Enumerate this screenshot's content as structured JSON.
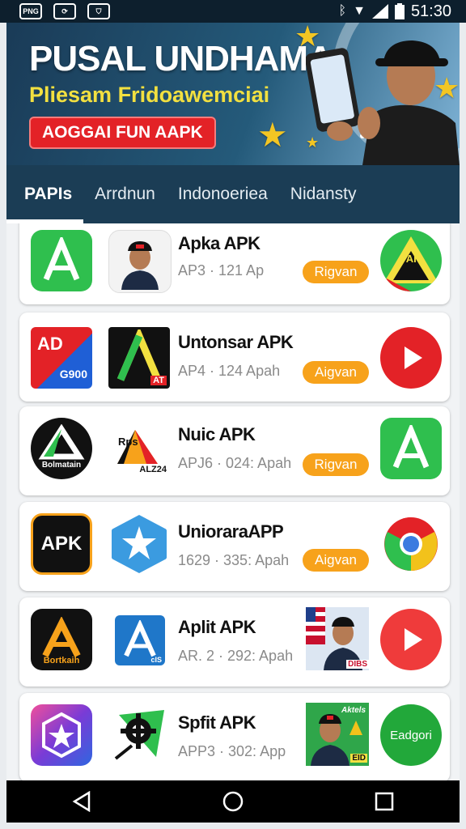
{
  "status_bar": {
    "icons": [
      "photo-icon",
      "sync-icon",
      "shield-icon"
    ],
    "photo_label": "PNG",
    "right_icons": [
      "bluetooth-icon",
      "wifi-icon",
      "signal-icon",
      "battery-icon"
    ],
    "time": "51:30"
  },
  "banner": {
    "title": "PUSAL UNDHAMA",
    "subtitle": "Pliesam Fridoawemciai",
    "button_label": "AOGGAI FUN AAPK",
    "colors": {
      "title": "#ffffff",
      "subtitle": "#f2e040",
      "button": "#e32227"
    }
  },
  "tabs": [
    {
      "label": "PAPIs",
      "active": true
    },
    {
      "label": "Arrdnun",
      "active": false
    },
    {
      "label": "Indonoeriea",
      "active": false
    },
    {
      "label": "Nidansty",
      "active": false
    }
  ],
  "apps": [
    {
      "name": "Apka APK",
      "meta": "AP3 · 121 Ap",
      "action": "Rigvan",
      "icon1": "green-a-icon",
      "icon2": "person-avatar-icon",
      "icon3": "triangle-flag-icon",
      "icon3_label": "PAI"
    },
    {
      "name": "Untonsar APK",
      "meta": "AP4 · 124 Apah",
      "action": "Aigvan",
      "icon1": "ad-badge-icon",
      "icon1_labels": [
        "AD",
        "G900"
      ],
      "icon2": "triangle-a-icon",
      "icon2_label": "AT",
      "icon3": "play-red-icon"
    },
    {
      "name": "Nuic APK",
      "meta": "APJ6 · 024: Apah",
      "action": "Rigvan",
      "icon1": "triangle-circle-icon",
      "icon1_label": "Bolmatain",
      "icon2": "arrow-logo-icon",
      "icon2_labels": [
        "Rps",
        "ALZ24"
      ],
      "icon3": "green-a-icon"
    },
    {
      "name": "UnioraraAPP",
      "meta": "1629 · 335: Apah",
      "action": "Aigvan",
      "icon1": "apk-badge-icon",
      "icon1_label": "APK",
      "icon2": "star-badge-icon",
      "icon3": "chrome-icon"
    },
    {
      "name": "Aplit APK",
      "meta": "AR. 2 · 292: Apah",
      "action": "",
      "icon1": "gold-a-icon",
      "icon1_label": "Bortkaih",
      "icon2": "blue-a-icon",
      "icon2_label": "cIS",
      "icon3": "person-flag-icon",
      "icon3_label": "DIBS"
    },
    {
      "name": "Spfit APK",
      "meta": "APP3 · 302: App",
      "action": "",
      "icon1": "purple-star-icon",
      "icon2": "gear-icon",
      "icon3": "person-green-icon",
      "icon3_label": "EID",
      "icon3_script": "Aktels"
    }
  ],
  "last_app_extra": {
    "label": "Eadgori"
  },
  "nav": [
    "back-icon",
    "home-icon",
    "recents-icon"
  ]
}
